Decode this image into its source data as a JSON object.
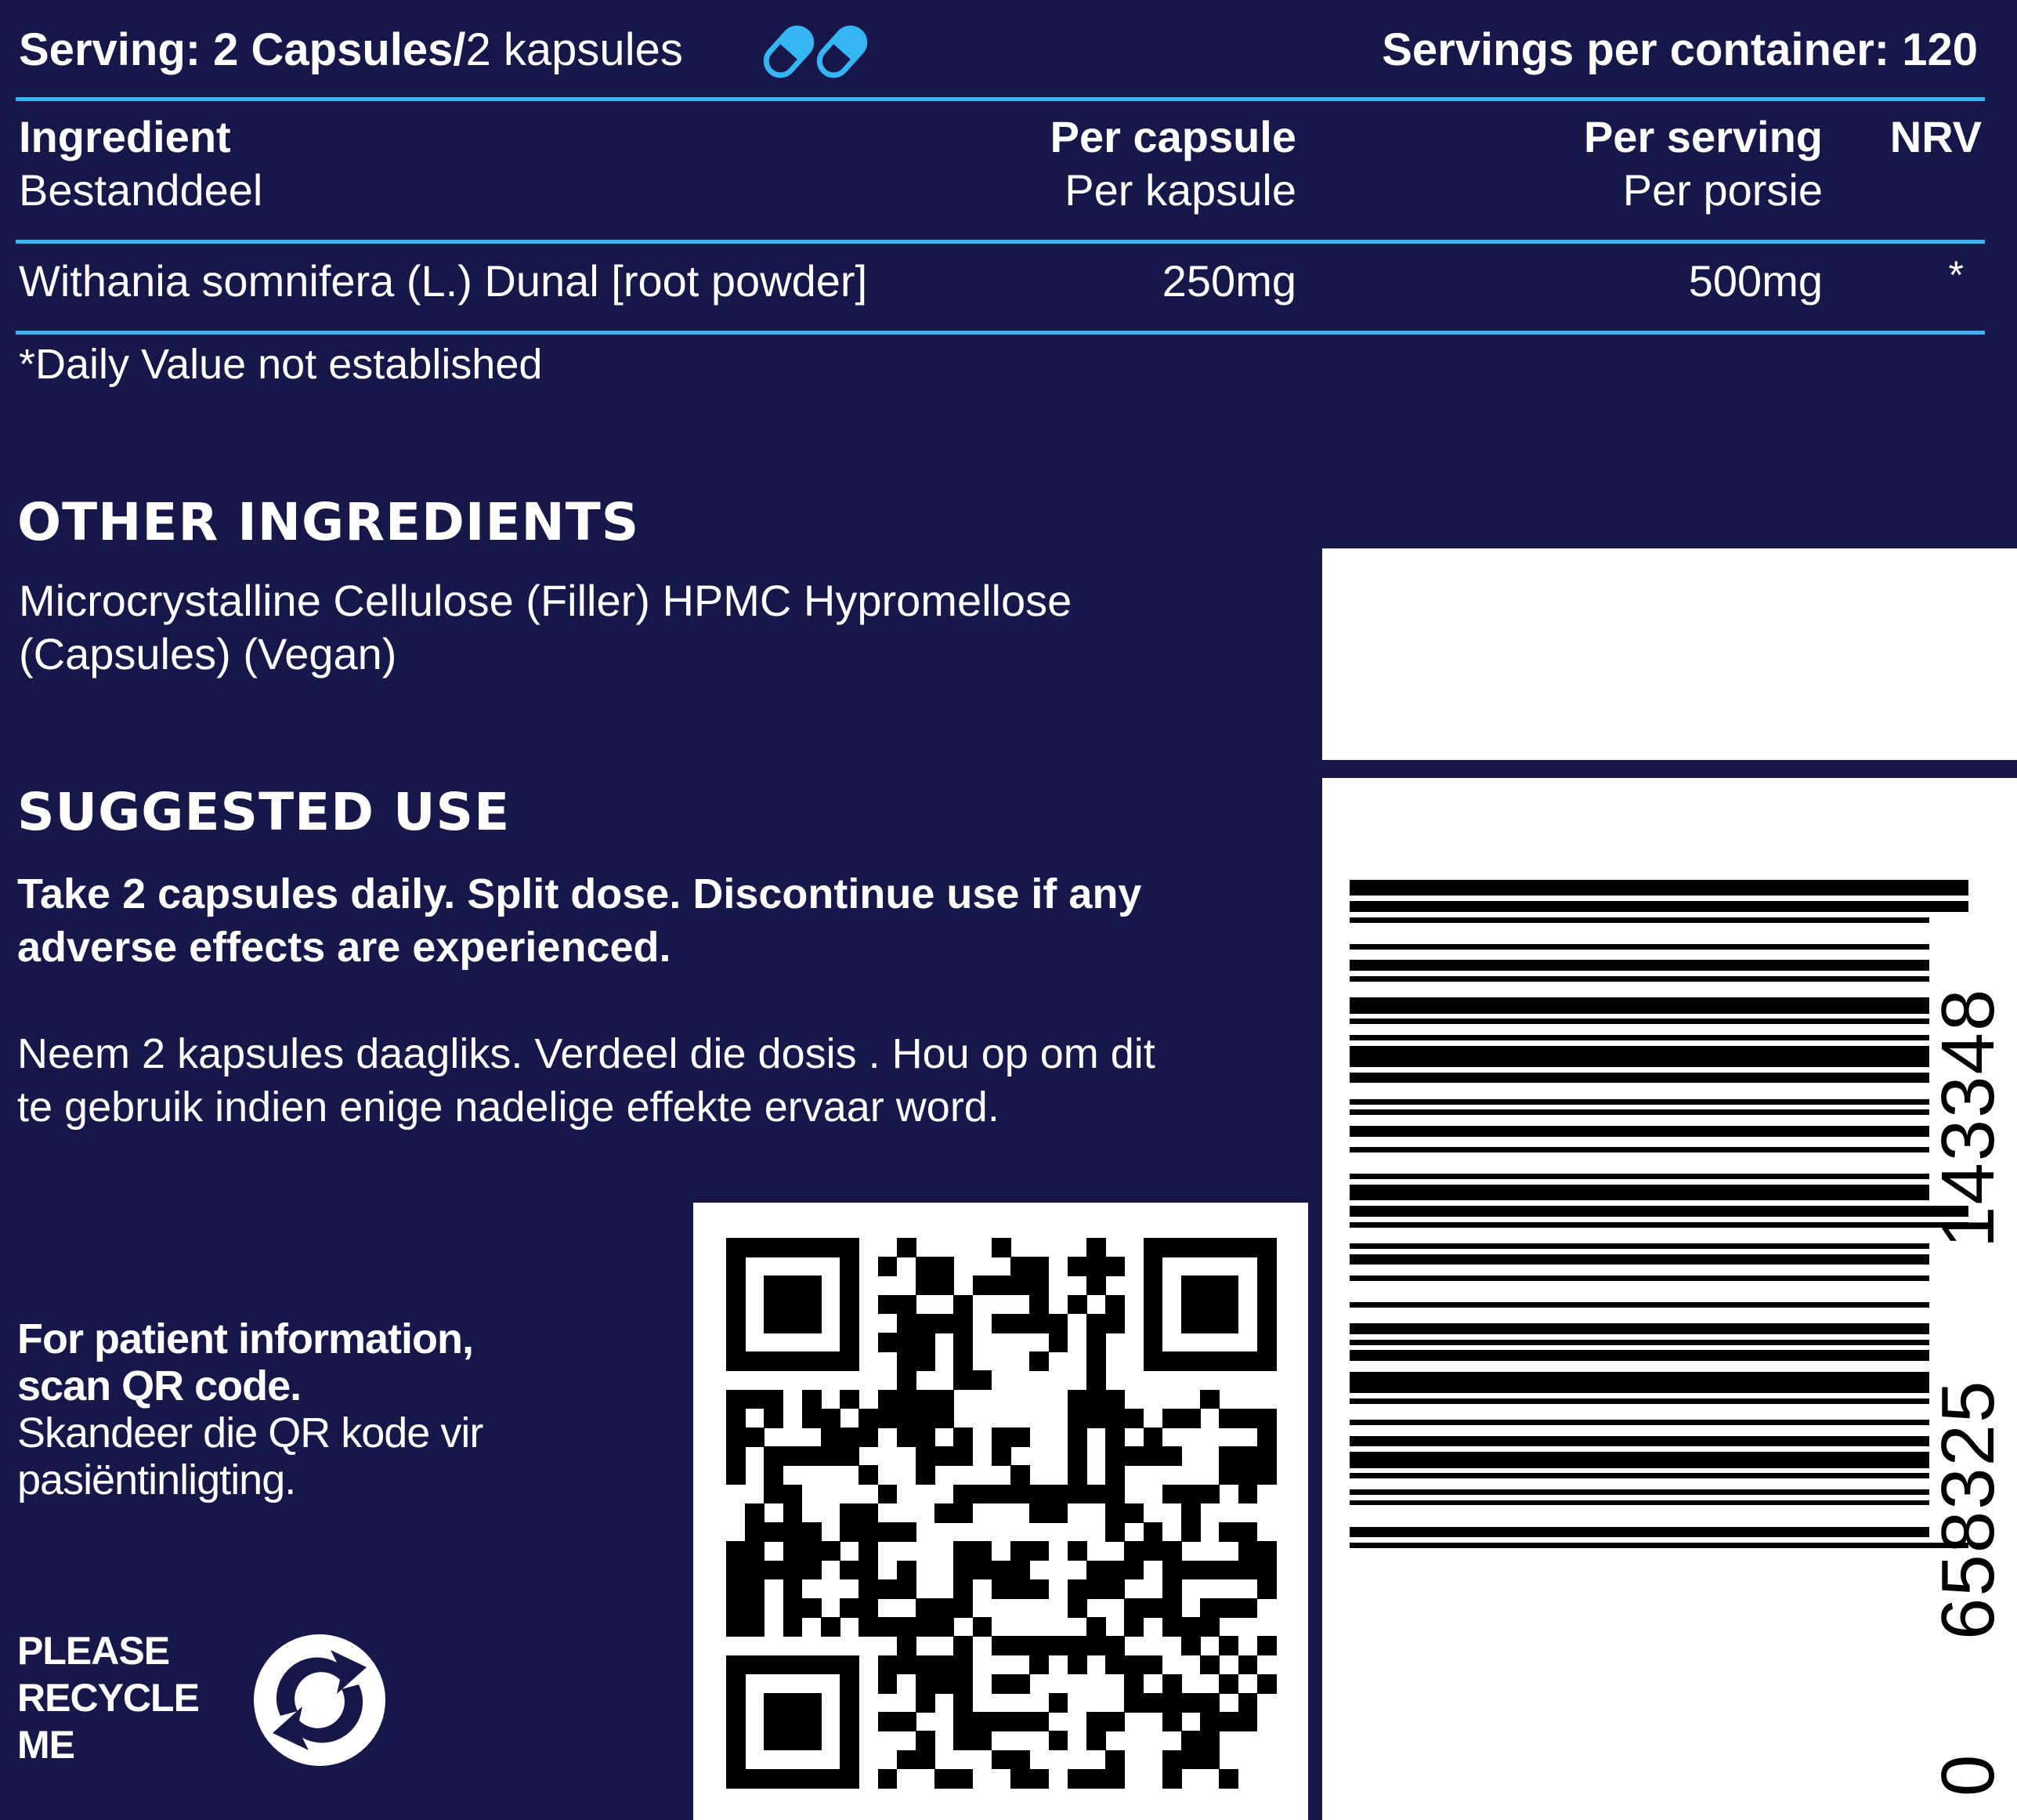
{
  "header": {
    "serving_bold": "Serving: 2 Capsules/",
    "serving_light": "2 kapsules",
    "capsule_icon": "capsule-icon",
    "servings_per_container": "Servings per container: 120"
  },
  "table": {
    "col_ingredient": "Ingredient",
    "col_ingredient_sub": "Bestanddeel",
    "col_per_capsule": "Per capsule",
    "col_per_capsule_sub": "Per kapsule",
    "col_per_serving": "Per serving",
    "col_per_serving_sub": "Per porsie",
    "col_nrv": "NRV",
    "rows": [
      {
        "ingredient": "Withania somnifera (L.) Dunal [root powder]",
        "per_capsule": "250mg",
        "per_serving": "500mg",
        "nrv": "*"
      }
    ],
    "footnote": "*Daily Value not established"
  },
  "other_ingredients": {
    "heading": "OTHER INGREDIENTS",
    "line1": "Microcrystalline Cellulose (Filler) HPMC Hypromellose",
    "line2": "(Capsules) (Vegan)"
  },
  "suggested_use": {
    "heading": "SUGGESTED USE",
    "en_line1": "Take 2 capsules daily. Split dose. Discontinue use if any",
    "en_line2": "adverse effects are experienced.",
    "af_line1": "Neem 2 kapsules daagliks. Verdeel die dosis . Hou op om dit",
    "af_line2": "te gebruik indien enige nadelige effekte ervaar word."
  },
  "patient_info": {
    "line1": "For patient information,",
    "line2": "scan QR code.",
    "line3": "Skandeer die QR kode vir",
    "line4": "pasiëntinligting."
  },
  "recycle": {
    "line1": "PLEASE",
    "line2": "RECYCLE",
    "line3": "ME",
    "icon": "recycle-icon"
  },
  "barcode": {
    "digit_first": "0",
    "group1": "658325",
    "group2": "143348"
  },
  "colors": {
    "background": "#17174a",
    "rule": "#35b6f2",
    "capsule_blue": "#35b6f2",
    "white": "#ffffff"
  }
}
